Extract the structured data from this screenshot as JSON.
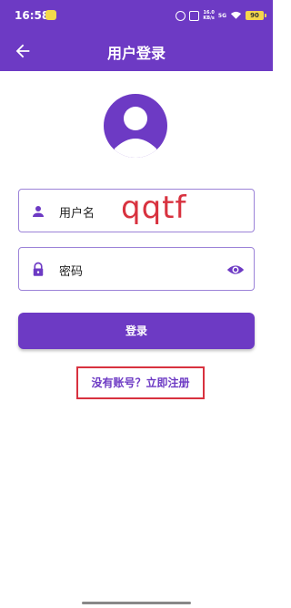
{
  "status_bar": {
    "time": "16:58",
    "speed_value": "16.0",
    "speed_unit": "KB/s",
    "network": "5G",
    "battery": "90",
    "icons": [
      "notification-icon",
      "alarm-icon",
      "mute-icon",
      "wifi-icon",
      "battery-icon"
    ]
  },
  "app_bar": {
    "title": "用户登录",
    "back_icon": "arrow-left-icon"
  },
  "form": {
    "username_placeholder": "用户名",
    "password_placeholder": "密码",
    "username_icon": "person-icon",
    "password_icon": "lock-icon",
    "visibility_icon": "eye-icon"
  },
  "login_button": {
    "label": "登录"
  },
  "register_link": {
    "label": "没有账号？立即注册"
  },
  "watermark": "qqtf",
  "colors": {
    "primary": "#6d3ac4",
    "annotation_red": "#d8323f",
    "field_border": "#9c83d8",
    "battery": "#f4d64b"
  }
}
